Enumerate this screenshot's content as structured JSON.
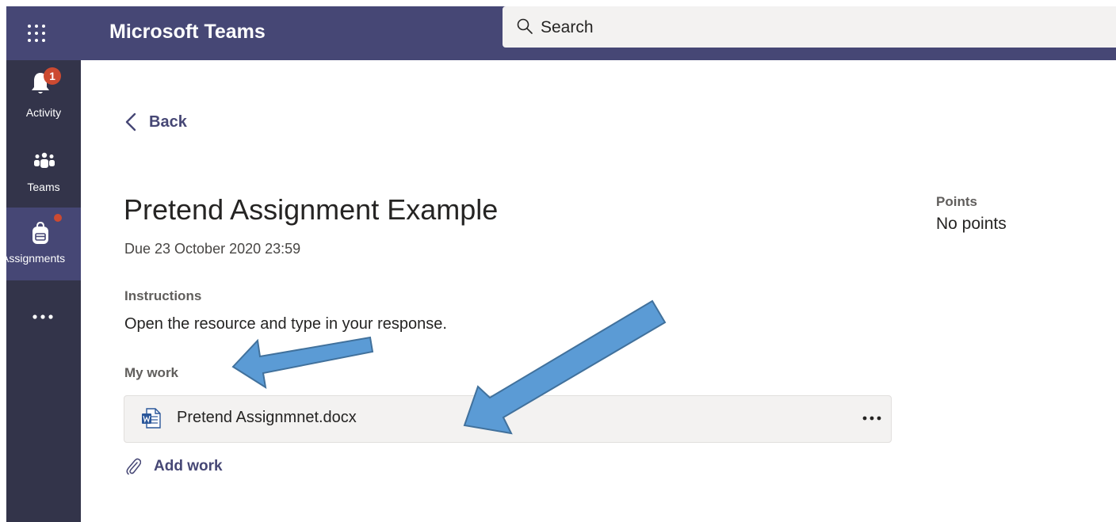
{
  "app": {
    "title": "Microsoft Teams"
  },
  "search": {
    "placeholder": "Search",
    "value": ""
  },
  "rail": {
    "items": [
      {
        "label": "Activity",
        "badge": "1",
        "icon": "bell-icon"
      },
      {
        "label": "Teams",
        "icon": "teams-icon"
      },
      {
        "label": "Assignments",
        "icon": "backpack-icon",
        "active": true
      },
      {
        "label": "...",
        "icon": "more-apps-icon"
      }
    ]
  },
  "nav": {
    "back_label": "Back"
  },
  "assignment": {
    "title": "Pretend Assignment Example",
    "due": "Due 23 October 2020 23:59",
    "instructions_label": "Instructions",
    "instructions": "Open the resource and type in your response.",
    "my_work_label": "My work",
    "file_name": "Pretend Assignmnet.docx",
    "add_work_label": "Add work"
  },
  "points": {
    "label": "Points",
    "value": "No points"
  },
  "colors": {
    "header": "#464775",
    "rail": "#33344a",
    "accent": "#464775",
    "badge": "#cc4a31",
    "annotation_arrow": "#5b9bd5"
  }
}
